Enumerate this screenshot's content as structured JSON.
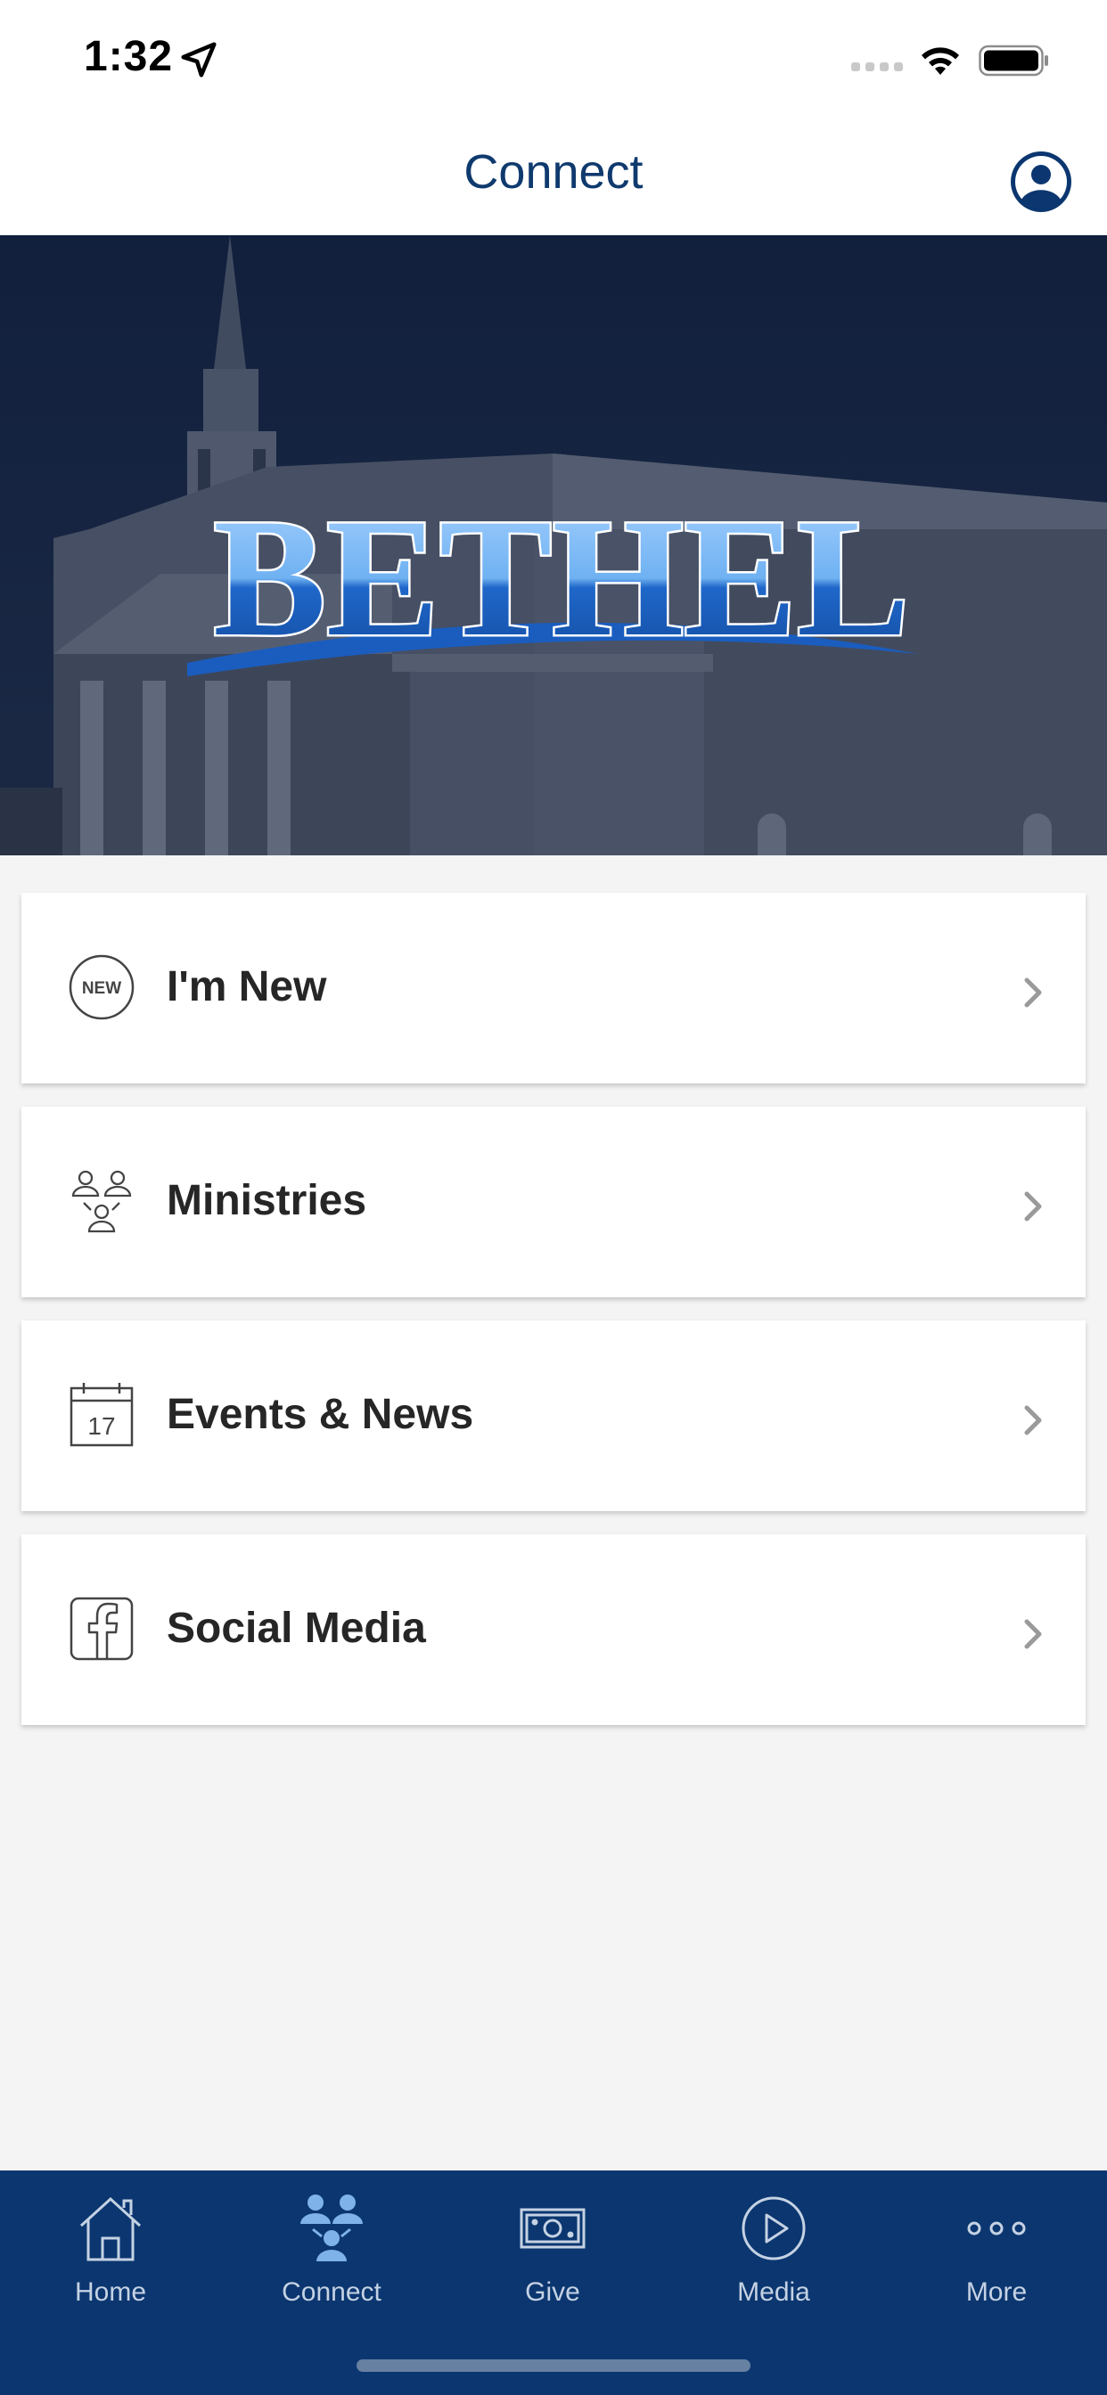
{
  "status_bar": {
    "time": "1:32"
  },
  "header": {
    "title": "Connect"
  },
  "hero": {
    "logo_text": "BETHEL"
  },
  "menu": {
    "items": [
      {
        "label": "I'm New",
        "icon": "new-badge-icon"
      },
      {
        "label": "Ministries",
        "icon": "people-group-icon"
      },
      {
        "label": "Events & News",
        "icon": "calendar-icon",
        "icon_text": "17"
      },
      {
        "label": "Social Media",
        "icon": "facebook-icon"
      }
    ],
    "new_badge_text": "NEW"
  },
  "tabs": [
    {
      "label": "Home",
      "icon": "home-icon"
    },
    {
      "label": "Connect",
      "icon": "people-icon",
      "active": true
    },
    {
      "label": "Give",
      "icon": "money-icon"
    },
    {
      "label": "Media",
      "icon": "play-icon"
    },
    {
      "label": "More",
      "icon": "more-icon"
    }
  ],
  "colors": {
    "brand_navy": "#0b3670",
    "title_blue": "#0f3a6e",
    "active_tab_icon": "#7fb2e8",
    "background": "#f4f4f4"
  }
}
